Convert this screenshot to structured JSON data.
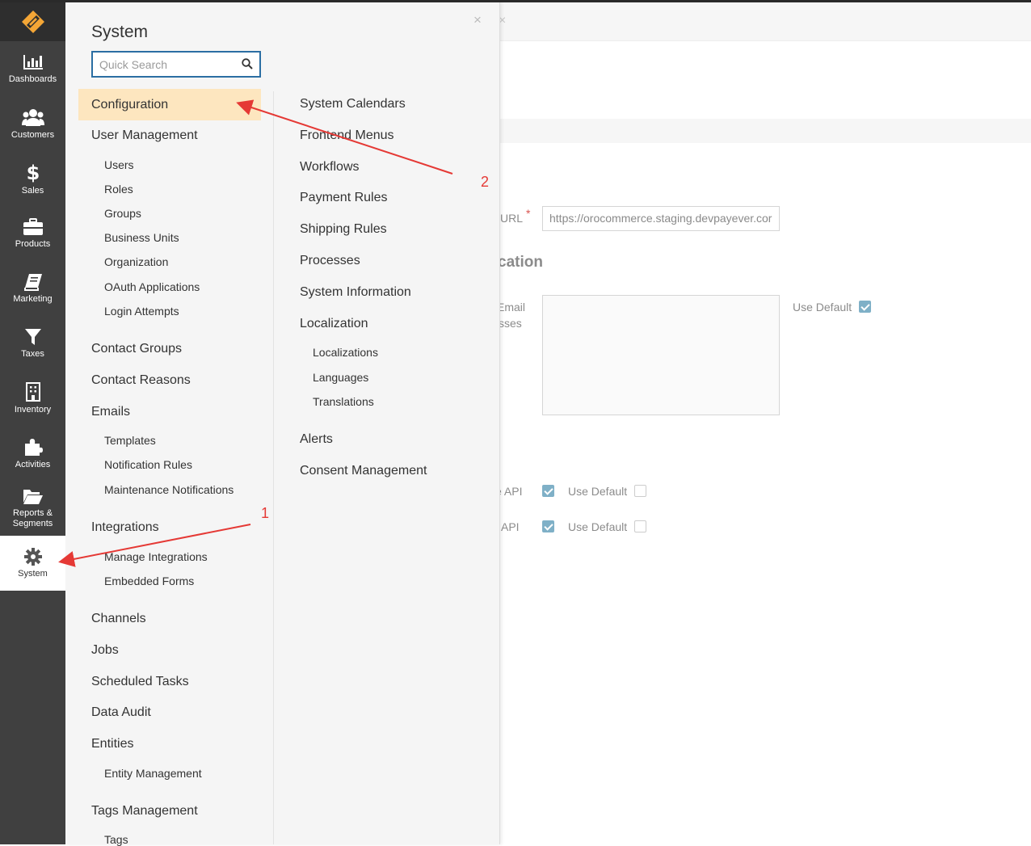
{
  "sidebar": {
    "items": [
      {
        "label": "Dashboards",
        "icon": "bar-chart-icon"
      },
      {
        "label": "Customers",
        "icon": "users-icon"
      },
      {
        "label": "Sales",
        "icon": "dollar-icon"
      },
      {
        "label": "Products",
        "icon": "briefcase-icon"
      },
      {
        "label": "Marketing",
        "icon": "book-icon"
      },
      {
        "label": "Taxes",
        "icon": "funnel-icon"
      },
      {
        "label": "Inventory",
        "icon": "building-icon"
      },
      {
        "label": "Activities",
        "icon": "puzzle-icon"
      },
      {
        "label": "Reports &\nSegments",
        "icon": "folder-open-icon"
      },
      {
        "label": "System",
        "icon": "gear-icon"
      }
    ],
    "active": "System"
  },
  "menu": {
    "title": "System",
    "search_placeholder": "Quick Search",
    "close": "×",
    "col1": [
      {
        "label": "Configuration",
        "level": 1,
        "highlight": true
      },
      {
        "label": "User Management",
        "level": 1
      },
      {
        "label": "Users",
        "level": 2
      },
      {
        "label": "Roles",
        "level": 2
      },
      {
        "label": "Groups",
        "level": 2
      },
      {
        "label": "Business Units",
        "level": 2
      },
      {
        "label": "Organization",
        "level": 2
      },
      {
        "label": "OAuth Applications",
        "level": 2
      },
      {
        "label": "Login Attempts",
        "level": 2
      },
      {
        "label": "Contact Groups",
        "level": 1
      },
      {
        "label": "Contact Reasons",
        "level": 1
      },
      {
        "label": "Emails",
        "level": 1
      },
      {
        "label": "Templates",
        "level": 2
      },
      {
        "label": "Notification Rules",
        "level": 2
      },
      {
        "label": "Maintenance Notifications",
        "level": 2
      },
      {
        "label": "Integrations",
        "level": 1
      },
      {
        "label": "Manage Integrations",
        "level": 2
      },
      {
        "label": "Embedded Forms",
        "level": 2
      },
      {
        "label": "Channels",
        "level": 1
      },
      {
        "label": "Jobs",
        "level": 1
      },
      {
        "label": "Scheduled Tasks",
        "level": 1
      },
      {
        "label": "Data Audit",
        "level": 1
      },
      {
        "label": "Entities",
        "level": 1
      },
      {
        "label": "Entity Management",
        "level": 2
      },
      {
        "label": "Tags Management",
        "level": 1
      },
      {
        "label": "Tags",
        "level": 2
      }
    ],
    "col2": [
      {
        "label": "System Calendars",
        "level": 1
      },
      {
        "label": "Frontend Menus",
        "level": 1
      },
      {
        "label": "Workflows",
        "level": 1
      },
      {
        "label": "Payment Rules",
        "level": 1
      },
      {
        "label": "Shipping Rules",
        "level": 1
      },
      {
        "label": "Processes",
        "level": 1
      },
      {
        "label": "System Information",
        "level": 1
      },
      {
        "label": "Localization",
        "level": 1
      },
      {
        "label": "Localizations",
        "level": 2
      },
      {
        "label": "Languages",
        "level": 2
      },
      {
        "label": "Translations",
        "level": 2
      },
      {
        "label": "Alerts",
        "level": 1
      },
      {
        "label": "Consent Management",
        "level": 1
      }
    ]
  },
  "background": {
    "close": "×",
    "url_label": "URL",
    "url_required": "*",
    "url_value": "https://orocommerce.staging.devpayever.cor",
    "section_heading": "cation",
    "email_label_1": "Email",
    "email_label_2": "sses",
    "use_default": "Use Default",
    "api_label_1": "e API",
    "api_label_2": "t API"
  },
  "annotations": {
    "label_1": "1",
    "label_2": "2",
    "color": "#e53935"
  },
  "colors": {
    "sidebar_bg": "#404040",
    "highlight": "#fde6bf",
    "search_border": "#2b6ea3",
    "checkbox_checked": "#7fb0c7"
  }
}
